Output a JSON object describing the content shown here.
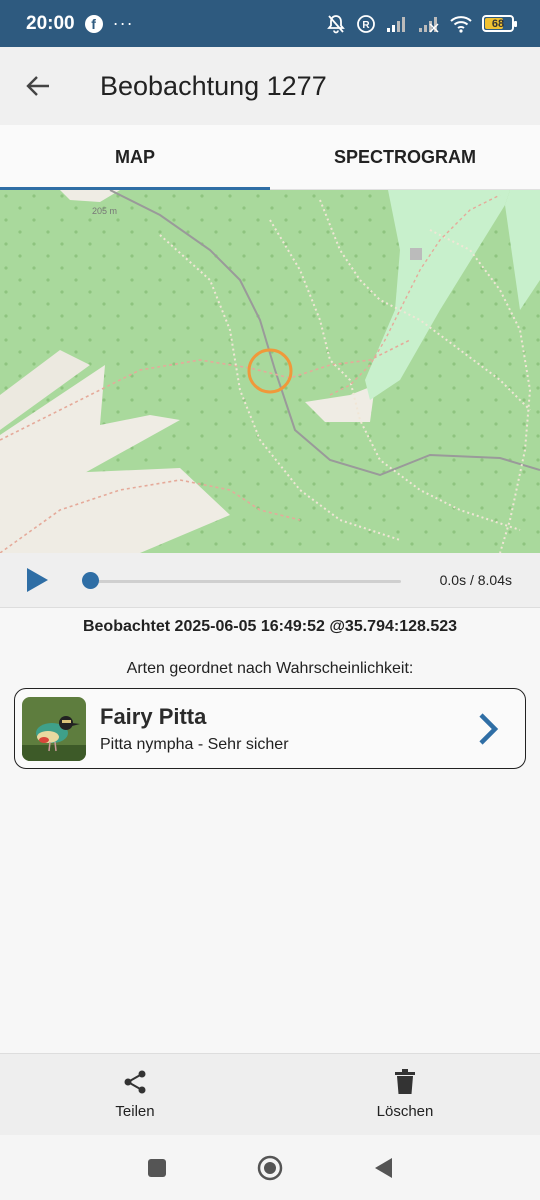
{
  "status_bar": {
    "time": "20:00",
    "notification_icons": [
      "facebook-icon",
      "more-dots-icon"
    ],
    "right_icons": [
      "muted-bell-icon",
      "registered-icon",
      "signal-icon",
      "signal-icon-2",
      "wifi-icon",
      "battery-icon"
    ],
    "battery_level": "68",
    "more": "···",
    "fb_letter": "f"
  },
  "app_bar": {
    "title": "Beobachtung 1277",
    "back_icon": "arrow-left-icon"
  },
  "tabs": [
    {
      "label": "MAP",
      "active": true
    },
    {
      "label": "SPECTROGRAM",
      "active": false
    }
  ],
  "map": {
    "marker_icon": "location-circle-icon",
    "label_elevation": "205 m"
  },
  "player": {
    "play_icon": "play-icon",
    "progress": 0.0,
    "time_display": "0.0s / 8.04s"
  },
  "observation": {
    "observed_line": "Beobachtet 2025-06-05 16:49:52 @35.794:128.523",
    "species_heading": "Arten geordnet nach Wahrscheinlichkeit:"
  },
  "species": [
    {
      "common_name": "Fairy Pitta",
      "detail": "Pitta nympha - Sehr sicher",
      "chevron_icon": "chevron-right-icon"
    }
  ],
  "bottom_actions": [
    {
      "label": "Teilen",
      "icon": "share-icon"
    },
    {
      "label": "Löschen",
      "icon": "trash-icon"
    }
  ],
  "nav_bar": {
    "icons": [
      "square-recents-icon",
      "circle-home-icon",
      "triangle-back-icon"
    ]
  },
  "colors": {
    "status_bar": "#2e5a7f",
    "accent": "#2f6ea5",
    "map_forest": "#a9d99c",
    "map_marker": "#f0993a"
  }
}
